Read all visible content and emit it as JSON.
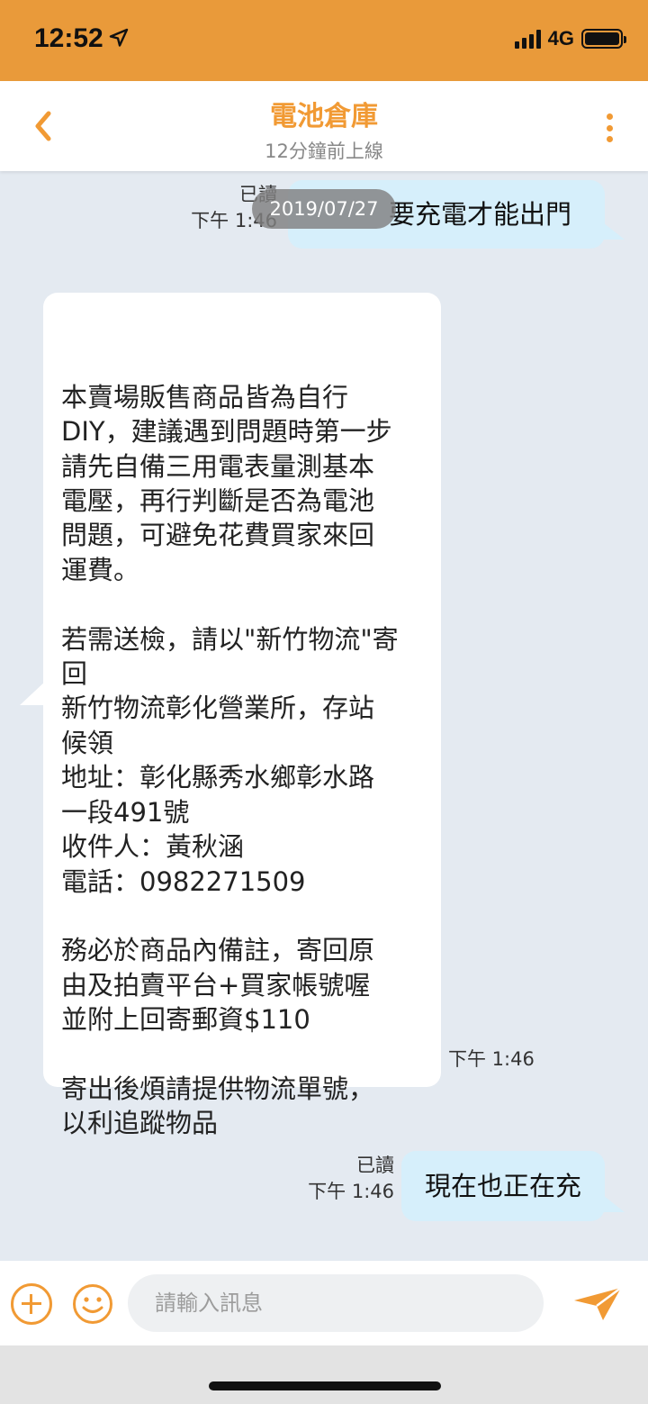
{
  "status_bar": {
    "time": "12:52",
    "network": "4G",
    "location_icon": "location-arrow-icon",
    "signal_icon": "signal-bars-icon",
    "battery_icon": "battery-icon"
  },
  "header": {
    "title": "電池倉庫",
    "subtitle": "12分鐘前上線",
    "back_icon": "chevron-left-icon",
    "more_icon": "more-vertical-icon",
    "accent_color": "#f19a34"
  },
  "chat": {
    "date_label": "2019/07/27",
    "messages": [
      {
        "direction": "out",
        "text": "要充電才能出門",
        "read": "已讀",
        "time": "下午 1:46"
      },
      {
        "direction": "in",
        "text": "本賣場販售商品皆為自行\nDIY，建議遇到問題時第一步\n請先自備三用電表量測基本\n電壓，再行判斷是否為電池\n問題，可避免花費買家來回\n運費。\n\n若需送檢，請以\"新竹物流\"寄\n回\n新竹物流彰化營業所，存站\n候領\n地址：彰化縣秀水鄉彰水路\n一段491號\n收件人：黃秋涵\n電話：0982271509\n\n務必於商品內備註，寄回原\n由及拍賣平台+買家帳號喔\n並附上回寄郵資$110\n\n寄出後煩請提供物流單號，\n以利追蹤物品",
        "time": "下午 1:46"
      },
      {
        "direction": "out",
        "text": "現在也正在充",
        "read": "已讀",
        "time": "下午 1:46"
      }
    ]
  },
  "input_bar": {
    "placeholder": "請輸入訊息",
    "add_icon": "plus-circle-icon",
    "emoji_icon": "smiley-icon",
    "send_icon": "send-icon"
  },
  "colors": {
    "status_bar": "#e99a3a",
    "chat_background": "#e4eaf1",
    "outgoing_bubble": "#d6effb",
    "incoming_bubble": "#ffffff"
  }
}
